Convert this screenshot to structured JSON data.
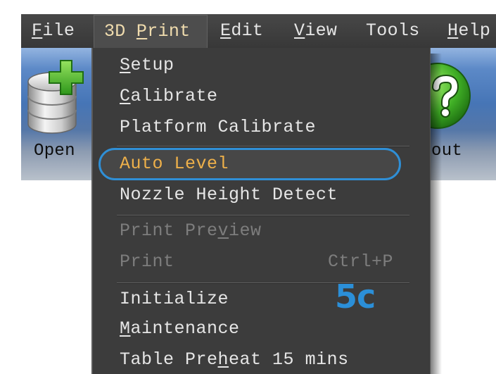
{
  "menubar": {
    "active_index": 1,
    "items": [
      {
        "label": "File",
        "underline": 0
      },
      {
        "label": "3D Print",
        "underline": 3
      },
      {
        "label": "Edit",
        "underline": 0
      },
      {
        "label": "View",
        "underline": 0
      },
      {
        "label": "Tools"
      },
      {
        "label": "Help",
        "underline": 0
      }
    ]
  },
  "toolbar": {
    "buttons": [
      {
        "label": "Open",
        "icon": "database-add-icon"
      },
      {
        "label": "out",
        "icon": "help-circle-icon"
      }
    ]
  },
  "menu": {
    "highlighted_index": 3,
    "items": [
      {
        "label": "Setup",
        "underline": 0,
        "enabled": true
      },
      {
        "label": "Calibrate",
        "underline": 0,
        "enabled": true
      },
      {
        "label": "Platform Calibrate",
        "enabled": true
      },
      {
        "label": "Auto Level",
        "enabled": true
      },
      {
        "label": "Nozzle Height Detect",
        "enabled": true
      },
      {
        "label": "Print Preview",
        "underline": 9,
        "enabled": false
      },
      {
        "label": "Print",
        "shortcut": "Ctrl+P",
        "enabled": false
      },
      {
        "label": "Initialize",
        "enabled": true
      },
      {
        "label": "Maintenance",
        "underline": 0,
        "enabled": true
      },
      {
        "label": "Table Preheat 15 mins",
        "underline": 9,
        "enabled": true
      }
    ]
  },
  "annotation": {
    "text": "5c"
  },
  "colors": {
    "menu_background": "#3c3c3c",
    "menu_text": "#e6e6e6",
    "disabled_text": "#7d7d7d",
    "highlighted_text": "#eeb04a",
    "highlight_outline": "#2f8fd6",
    "annotation": "#2b8fd8"
  }
}
